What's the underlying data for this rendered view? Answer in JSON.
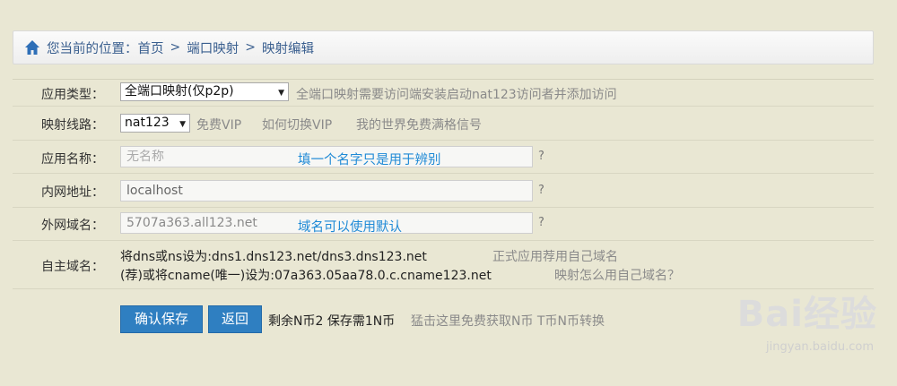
{
  "breadcrumb": {
    "prefix": "您当前的位置：",
    "items": [
      "首页",
      "端口映射",
      "映射编辑"
    ],
    "separator": ">"
  },
  "form": {
    "app_type": {
      "label": "应用类型：",
      "value": "全端口映射(仅p2p)",
      "hint": "全端口映射需要访问端安装启动nat123访问者并添加访问"
    },
    "line": {
      "label": "映射线路：",
      "value": "nat123",
      "hints": [
        "免费VIP",
        "如何切换VIP",
        "我的世界免费满格信号"
      ]
    },
    "app_name": {
      "label": "应用名称：",
      "placeholder": "无名称",
      "note": "填一个名字只是用于辨别",
      "help": "?"
    },
    "lan_addr": {
      "label": "内网地址：",
      "value": "localhost",
      "help": "?"
    },
    "wan_domain": {
      "label": "外网域名：",
      "value": "5707a363.all123.net",
      "note": "域名可以使用默认",
      "help": "?"
    },
    "custom_domain": {
      "label": "自主域名：",
      "line1": "将dns或ns设为:dns1.dns123.net/dns3.dns123.net",
      "line1_hint": "正式应用荐用自己域名",
      "line2": "(荐)或将cname(唯一)设为:07a363.05aa78.0.c.cname123.net",
      "line2_hint": "映射怎么用自己域名？"
    },
    "actions": {
      "save": "确认保存",
      "back": "返回",
      "balance": "剩余N币2 保存需1N币",
      "hint": "猛击这里免费获取N币 T币N币转换"
    }
  },
  "watermark": {
    "brand": "Bai经验",
    "site": "jingyan.baidu.com"
  }
}
